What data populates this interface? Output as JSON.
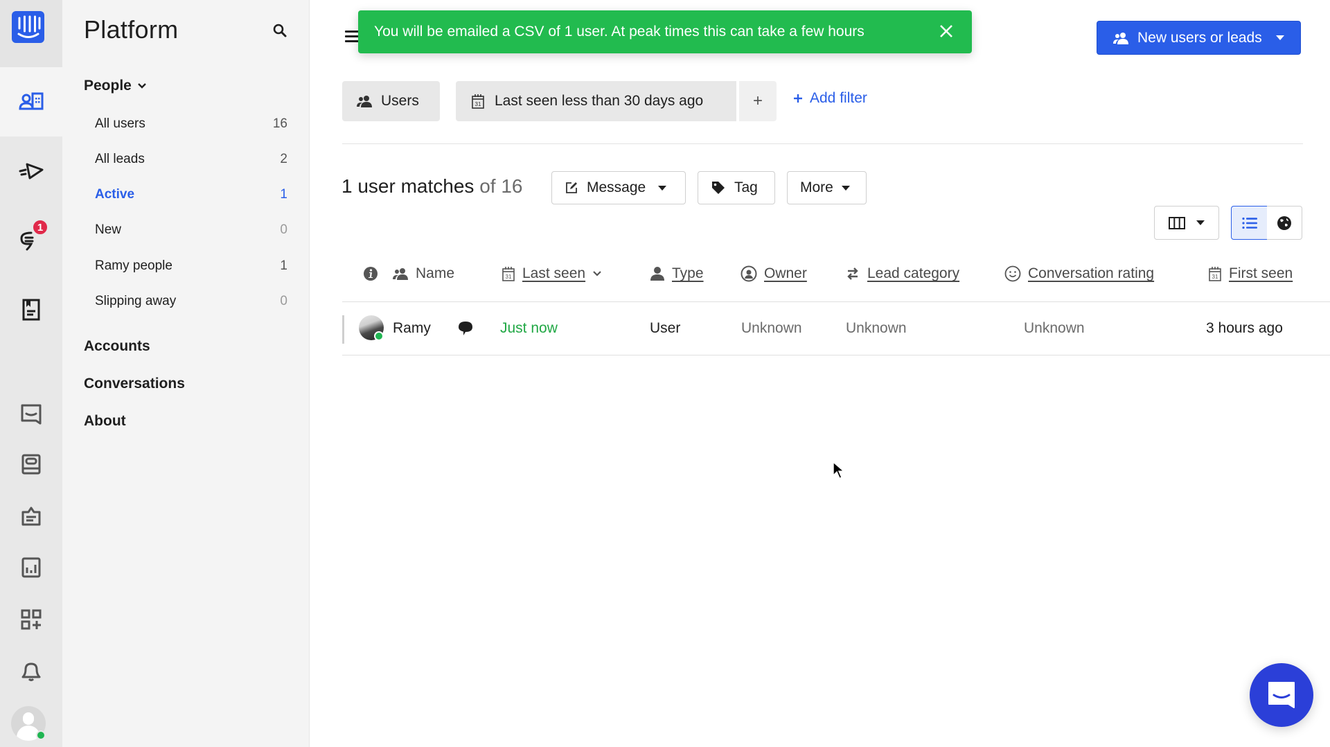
{
  "rail": {
    "logo_icon": "intercom-logo-icon",
    "items": [
      {
        "icon": "contacts-icon",
        "active": true
      },
      {
        "icon": "outbound-send-icon"
      },
      {
        "icon": "inbox-conversations-icon",
        "badge": "1"
      },
      {
        "icon": "articles-icon"
      },
      {
        "icon": "messenger-icon"
      },
      {
        "icon": "help-center-icon"
      },
      {
        "icon": "operator-icon"
      },
      {
        "icon": "reports-icon"
      },
      {
        "icon": "app-store-icon"
      },
      {
        "icon": "notifications-bell-icon"
      }
    ],
    "user_status": "online"
  },
  "sidebar": {
    "title": "Platform",
    "search_icon": "search-icon",
    "sections": {
      "people": "People",
      "accounts": "Accounts",
      "conversations": "Conversations",
      "about": "About"
    },
    "segments": [
      {
        "label": "All users",
        "count": "16"
      },
      {
        "label": "All leads",
        "count": "2"
      },
      {
        "label": "Active",
        "count": "1",
        "active": true
      },
      {
        "label": "New",
        "count": "0"
      },
      {
        "label": "Ramy people",
        "count": "1"
      },
      {
        "label": "Slipping away",
        "count": "0"
      }
    ]
  },
  "toast": {
    "message": "You will be emailed a CSV of 1 user. At peak times this can take a few hours",
    "color": "#22bb4f"
  },
  "header": {
    "primary_button": "New users or leads",
    "accent_color": "#2a5ee8"
  },
  "filters": {
    "type_chip": "Users",
    "filter_chip": {
      "bold": "Last seen",
      "rest": " less than 30 days ago"
    },
    "plus": "+",
    "add_filter": "Add filter"
  },
  "results": {
    "count_text": "1 user matches",
    "total_text": "of 16",
    "actions": {
      "message": "Message",
      "tag": "Tag",
      "more": "More"
    },
    "view": {
      "selected": "list"
    }
  },
  "table": {
    "columns": [
      {
        "key": "name",
        "label": "Name",
        "icon": "users-icon"
      },
      {
        "key": "last_seen",
        "label": "Last seen",
        "icon": "calendar-icon",
        "sorted": "desc"
      },
      {
        "key": "type",
        "label": "Type",
        "icon": "person-icon"
      },
      {
        "key": "owner",
        "label": "Owner",
        "icon": "owner-icon"
      },
      {
        "key": "lead_category",
        "label": "Lead category",
        "icon": "swap-icon"
      },
      {
        "key": "conversation_rating",
        "label": "Conversation rating",
        "icon": "smiley-icon"
      },
      {
        "key": "first_seen",
        "label": "First seen",
        "icon": "calendar-icon"
      }
    ],
    "rows": [
      {
        "name": "Ramy",
        "online": true,
        "last_seen": "Just now",
        "type": "User",
        "owner": "Unknown",
        "lead_category": "Unknown",
        "conversation_rating": "Unknown",
        "first_seen": "3 hours ago"
      }
    ]
  }
}
